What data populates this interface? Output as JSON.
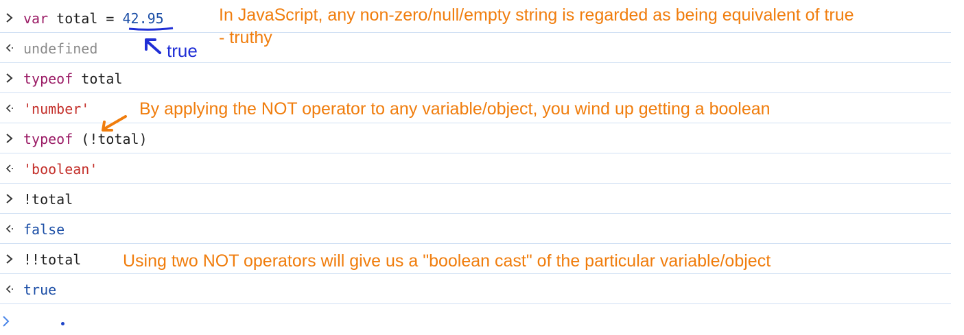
{
  "console": {
    "rows": [
      {
        "kind": "input",
        "tokens": [
          "var",
          " total = ",
          "42.95"
        ]
      },
      {
        "kind": "output",
        "text": "undefined"
      },
      {
        "kind": "input",
        "tokens": [
          "typeof",
          " total"
        ]
      },
      {
        "kind": "output",
        "text": "'number'"
      },
      {
        "kind": "input",
        "tokens": [
          "typeof",
          " (!total)"
        ]
      },
      {
        "kind": "output",
        "text": "'boolean'"
      },
      {
        "kind": "input",
        "tokens": [
          "!total"
        ]
      },
      {
        "kind": "output",
        "text": "false"
      },
      {
        "kind": "input",
        "tokens": [
          "!!total"
        ]
      },
      {
        "kind": "output",
        "text": "true"
      }
    ]
  },
  "annotations": {
    "truthy_line1": "In JavaScript, any non-zero/null/empty string is regarded as being equivalent of true",
    "truthy_line2": "- truthy",
    "true_label": "true",
    "not_operator": "By applying the NOT operator to any variable/object, you wind up getting a boolean",
    "double_not": "Using two NOT operators will give us a \"boolean cast\" of the particular variable/object"
  },
  "colors": {
    "keyword": "#9b1c66",
    "number": "#1b4ea6",
    "string": "#c4302b",
    "annotation_orange": "#f07d0d",
    "annotation_blue": "#1f2ed6"
  },
  "icons": {
    "input_prompt": "chevron-right-icon",
    "output_result": "return-arrow-icon",
    "annotation_arrow": "arrow-icon"
  }
}
